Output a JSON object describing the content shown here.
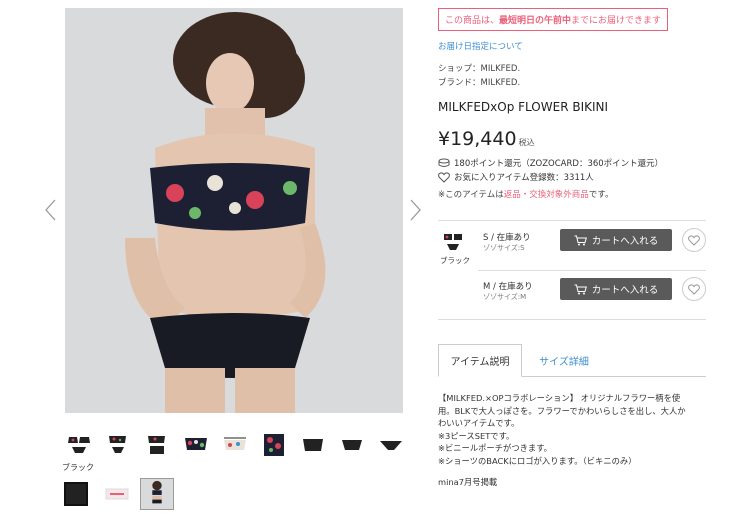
{
  "delivery": {
    "prefix": "この商品は、",
    "emph": "最短明日の午前中",
    "suffix": "までにお届けできます",
    "date_link": "お届け日指定について"
  },
  "shop_line": "ショップ：MILKFED.",
  "brand_line": "ブランド：MILKFED.",
  "product_name": "MILKFEDxOp FLOWER BIKINI",
  "price": {
    "amount": "¥19,440",
    "tax": "税込"
  },
  "points_line": "180ポイント還元（ZOZOCARD：360ポイント還元）",
  "favorites_line": "お気に入りアイテム登録数：3311人",
  "notice": {
    "prefix": "※このアイテムは",
    "highlight": "返品・交換対象外商品",
    "suffix": "です。"
  },
  "color_label": "ブラック",
  "skus": [
    {
      "size": "S / 在庫あり",
      "sub": "ゾゾサイズ:S",
      "cart_label": "カートへ入れる"
    },
    {
      "size": "M / 在庫あり",
      "sub": "ゾゾサイズ:M",
      "cart_label": "カートへ入れる"
    }
  ],
  "tabs": {
    "item_desc": "アイテム説明",
    "size_detail": "サイズ詳細"
  },
  "description": {
    "lines": [
      "【MILKFED.×OPコラボレーション】 オリジナルフラワー柄を使",
      "用。BLKで大人っぽさを。フラワーでかわいらしさを出し、大人か",
      "わいいアイテムです。",
      "※3ピースSETです。",
      "※ビニールポーチがつきます。",
      "※ショーツのBACKにロゴが入ります。（ビキニのみ）"
    ],
    "footer": "mina7月号掲載"
  },
  "thumbnail_caption": "ブラック",
  "colors": {
    "accent_red": "#e86079",
    "link_blue": "#3e8ed0",
    "button_gray": "#5a5a5a"
  }
}
